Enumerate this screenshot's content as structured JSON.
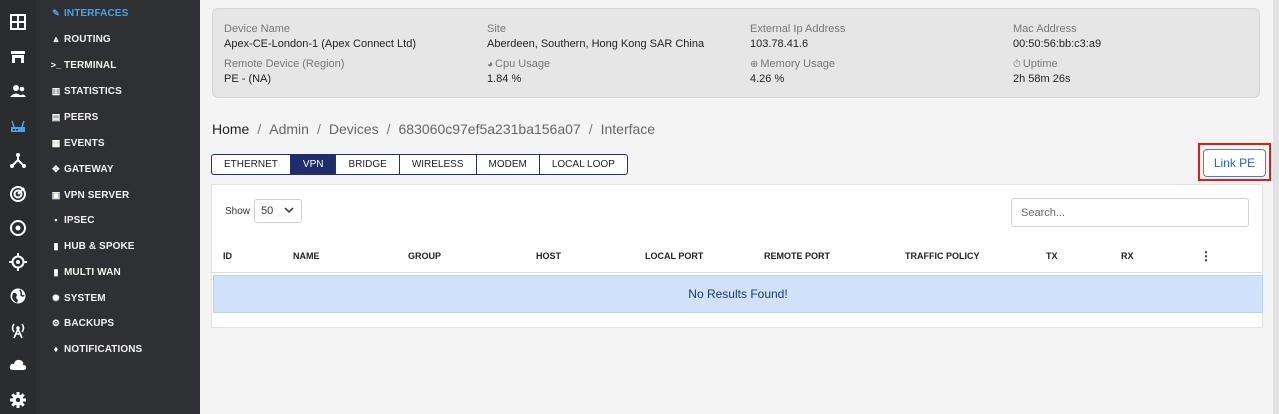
{
  "rail": [
    {
      "name": "dashboard-icon",
      "active": false
    },
    {
      "name": "store-icon",
      "active": false
    },
    {
      "name": "users-icon",
      "active": false
    },
    {
      "name": "router-icon",
      "active": true
    },
    {
      "name": "network-icon",
      "active": false
    },
    {
      "name": "radar-icon",
      "active": false
    },
    {
      "name": "target-icon",
      "active": false
    },
    {
      "name": "crosshair-icon",
      "active": false
    },
    {
      "name": "globe-icon",
      "active": false
    },
    {
      "name": "antenna-icon",
      "active": false
    },
    {
      "name": "cloud-icon",
      "active": false
    },
    {
      "name": "settings-icon",
      "active": false
    }
  ],
  "menu": [
    {
      "label": "INTERFACES",
      "glyph": "✎",
      "active": true
    },
    {
      "label": "ROUTING",
      "glyph": "⩓",
      "active": false
    },
    {
      "label": "TERMINAL",
      "glyph": ">_",
      "active": false
    },
    {
      "label": "STATISTICS",
      "glyph": "▥",
      "active": false
    },
    {
      "label": "PEERS",
      "glyph": "▤",
      "active": false
    },
    {
      "label": "EVENTS",
      "glyph": "▦",
      "active": false
    },
    {
      "label": "GATEWAY",
      "glyph": "✥",
      "active": false
    },
    {
      "label": "VPN SERVER",
      "glyph": "▣",
      "active": false
    },
    {
      "label": "IPSEC",
      "glyph": "▪",
      "active": false
    },
    {
      "label": "HUB & SPOKE",
      "glyph": "▮",
      "active": false
    },
    {
      "label": "MULTI WAN",
      "glyph": "▮",
      "active": false
    },
    {
      "label": "SYSTEM",
      "glyph": "✺",
      "active": false
    },
    {
      "label": "BACKUPS",
      "glyph": "⚙",
      "active": false
    },
    {
      "label": "NOTIFICATIONS",
      "glyph": "♦",
      "active": false
    }
  ],
  "device": {
    "name_label": "Device Name",
    "name_value": "Apex-CE-London-1 (Apex Connect Ltd)",
    "site_label": "Site",
    "site_value": "Aberdeen, Southern, Hong Kong SAR China",
    "ext_ip_label": "External Ip Address",
    "ext_ip_value": "103.78.41.6",
    "mac_label": "Mac Address",
    "mac_value": "00:50:56:bb:c3:a9",
    "remote_label": "Remote Device (Region)",
    "remote_value": "PE - (NA)",
    "cpu_label": "Cpu Usage",
    "cpu_value": "1.84 %",
    "mem_label": "Memory Usage",
    "mem_value": "4.26 %",
    "uptime_label": "Uptime",
    "uptime_value": "2h 58m 26s"
  },
  "breadcrumb": [
    "Home",
    "Admin",
    "Devices",
    "683060c97ef5a231ba156a07",
    "Interface"
  ],
  "breadcrumb_sep": "/",
  "tabs": [
    {
      "label": "ETHERNET",
      "active": false
    },
    {
      "label": "VPN",
      "active": true
    },
    {
      "label": "BRIDGE",
      "active": false
    },
    {
      "label": "WIRELESS",
      "active": false
    },
    {
      "label": "MODEM",
      "active": false
    },
    {
      "label": "LOCAL LOOP",
      "active": false
    }
  ],
  "link_pe_label": "Link PE",
  "table": {
    "show_label": "Show",
    "page_size": "50",
    "search_placeholder": "Search...",
    "columns": [
      "ID",
      "NAME",
      "GROUP",
      "HOST",
      "LOCAL PORT",
      "REMOTE PORT",
      "TRAFFIC POLICY",
      "TX",
      "RX"
    ],
    "empty_message": "No Results Found!"
  }
}
